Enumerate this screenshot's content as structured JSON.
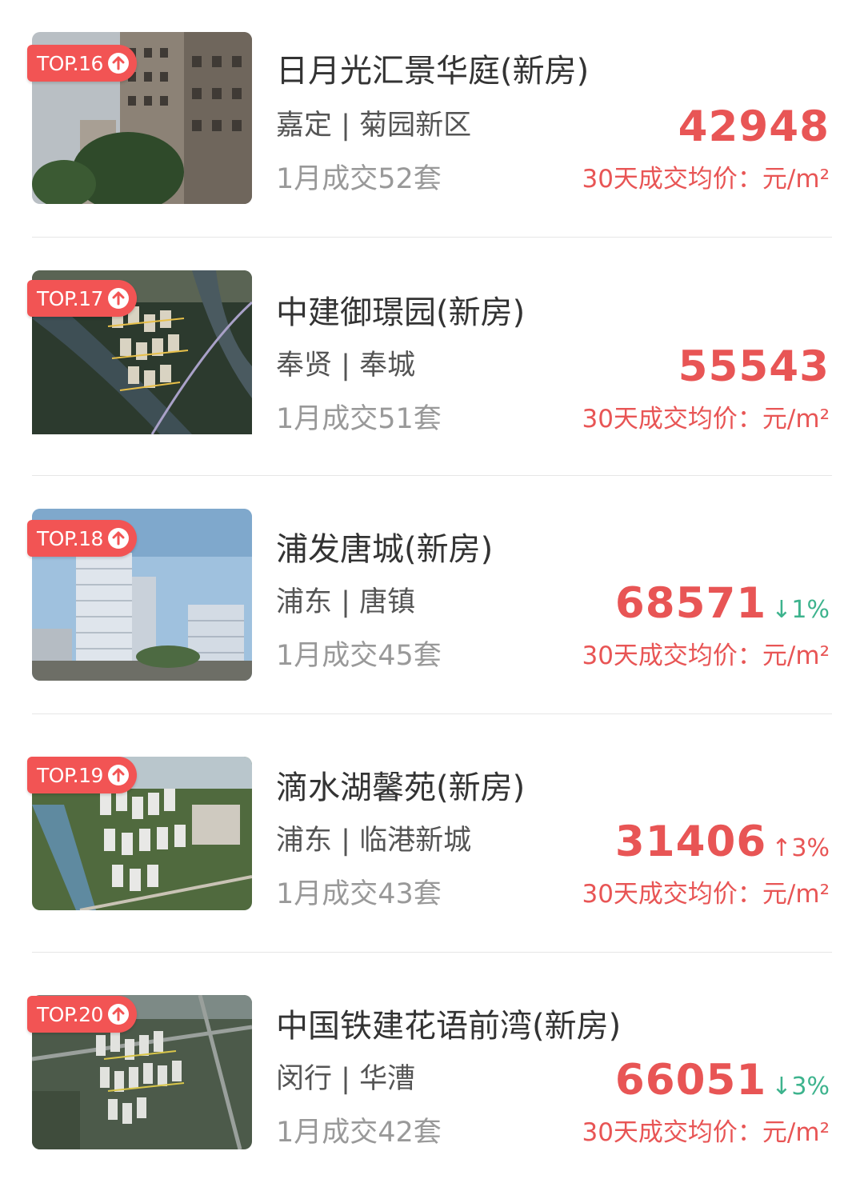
{
  "accent_color": "#f25454",
  "price_color": "#e85555",
  "down_color": "#3db38d",
  "items": [
    {
      "rank": "TOP.16",
      "rank_icon": "arrow-up-circle-icon",
      "name": "日月光汇景华庭(新房)",
      "district": "嘉定",
      "area": "菊园新区",
      "sales": "1月成交52套",
      "price": "42948",
      "change": "",
      "change_dir": "",
      "price_label": "30天成交均价：元/m²"
    },
    {
      "rank": "TOP.17",
      "rank_icon": "arrow-up-circle-icon",
      "name": "中建御璟园(新房)",
      "district": "奉贤",
      "area": "奉城",
      "sales": "1月成交51套",
      "price": "55543",
      "change": "",
      "change_dir": "",
      "price_label": "30天成交均价：元/m²"
    },
    {
      "rank": "TOP.18",
      "rank_icon": "arrow-up-circle-icon",
      "name": "浦发唐城(新房)",
      "district": "浦东",
      "area": "唐镇",
      "sales": "1月成交45套",
      "price": "68571",
      "change": "↓1%",
      "change_dir": "down",
      "price_label": "30天成交均价：元/m²"
    },
    {
      "rank": "TOP.19",
      "rank_icon": "arrow-up-circle-icon",
      "name": "滴水湖馨苑(新房)",
      "district": "浦东",
      "area": "临港新城",
      "sales": "1月成交43套",
      "price": "31406",
      "change": "↑3%",
      "change_dir": "up",
      "price_label": "30天成交均价：元/m²"
    },
    {
      "rank": "TOP.20",
      "rank_icon": "arrow-up-circle-icon",
      "name": "中国铁建花语前湾(新房)",
      "district": "闵行",
      "area": "华漕",
      "sales": "1月成交42套",
      "price": "66051",
      "change": "↓3%",
      "change_dir": "down",
      "price_label": "30天成交均价：元/m²"
    }
  ]
}
